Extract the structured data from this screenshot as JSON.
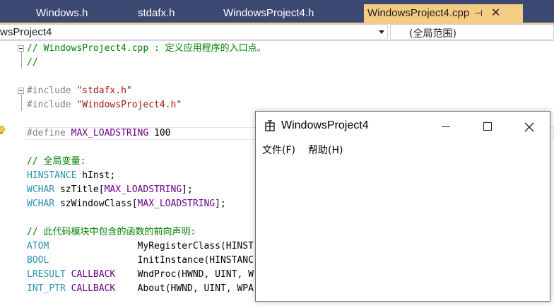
{
  "tabs": [
    {
      "label": "Windows.h",
      "active": false
    },
    {
      "label": "stdafx.h",
      "active": false
    },
    {
      "label": "WindowsProject4.h",
      "active": false
    },
    {
      "label": "WindowsProject4.cpp",
      "active": true
    }
  ],
  "tab_pin_glyph": "⊣",
  "tab_close_glyph": "✕",
  "navbar": {
    "project": "wsProject4",
    "scope": "(全局范围)"
  },
  "code": {
    "line1": {
      "comment": "// WindowsProject4.cpp : 定义应用程序的入口点。"
    },
    "line2": {
      "comment": "//"
    },
    "line4": {
      "pre": "#include ",
      "str": "\"stdafx.h\""
    },
    "line5": {
      "pre": "#include ",
      "str": "\"WindowsProject4.h\""
    },
    "line7": {
      "pre": "#define ",
      "macro": "MAX_LOADSTRING",
      "value": " 100"
    },
    "line9": {
      "comment": "// 全局变量:"
    },
    "line10": {
      "type": "HINSTANCE",
      "rest": " hInst;"
    },
    "line11": {
      "type": "WCHAR",
      "mid": " szTitle[",
      "macro": "MAX_LOADSTRING",
      "end": "];"
    },
    "line12": {
      "type": "WCHAR",
      "mid": " szWindowClass[",
      "macro": "MAX_LOADSTRING",
      "end": "];"
    },
    "line14": {
      "comment": "// 此代码模块中包含的函数的前向声明:"
    },
    "line15": {
      "type": "ATOM",
      "pad": "                ",
      "rest": "MyRegisterClass(HINST"
    },
    "line16": {
      "type": "BOOL",
      "pad": "                ",
      "rest": "InitInstance(HINSTANC"
    },
    "line17": {
      "type": "LRESULT",
      "sp": " ",
      "macro": "CALLBACK",
      "pad": "    ",
      "rest": "WndProc(HWND, UINT, W"
    },
    "line18": {
      "type": "INT_PTR",
      "sp": " ",
      "macro": "CALLBACK",
      "pad": "    ",
      "rest": "About(HWND, UINT, WPA"
    }
  },
  "lightbulb_icon": "lightbulb-icon",
  "app_window": {
    "title": "WindowsProject4",
    "menu": [
      "文件(F)",
      "帮助(H)"
    ],
    "icon": "app-window-icon"
  },
  "colors": {
    "tabstrip": "#3c4a73",
    "active_tab": "#f5cc84",
    "comment": "#008000",
    "string": "#a31515",
    "type": "#2b91af",
    "macro": "#6f008a",
    "preprocessor": "#808080"
  }
}
